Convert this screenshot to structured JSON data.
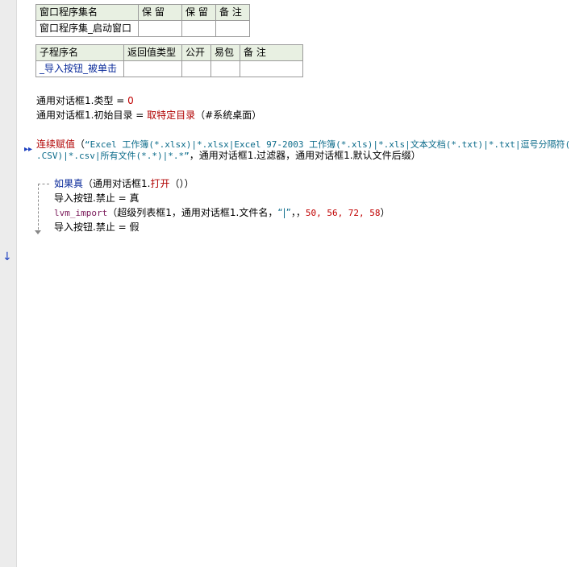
{
  "table1": {
    "headers": [
      "窗口程序集名",
      "保 留",
      "保 留",
      "备 注"
    ],
    "row": [
      "窗口程序集_启动窗口",
      "",
      "",
      ""
    ]
  },
  "table2": {
    "headers": [
      "子程序名",
      "返回值类型",
      "公开",
      "易包",
      "备 注"
    ],
    "row": [
      "_导入按钮_被单击",
      "",
      "",
      "",
      ""
    ]
  },
  "code": {
    "l1_obj": "通用对话框1.类型",
    "l1_eq": " = ",
    "l1_val": "0",
    "l2_obj": "通用对话框1.初始目录",
    "l2_eq": " = ",
    "l2_fn": "取特定目录",
    "l2_arg": "（#系统桌面）",
    "l3_fn": "连续赋值",
    "l3_open": "（",
    "l3_str1": "“Excel 工作簿(*.xlsx)|*.xlsx|Excel 97-2003 工作簿(*.xls)|*.xls|文本文档(*.txt)|*.txt|逗号分隔符(*",
    "l3_str2": ".CSV)|*.csv|所有文件(*.*)|*.*”",
    "l3_rest": "，通用对话框1.过滤器，通用对话框1.默认文件后缀）",
    "if_kw": "如果真",
    "if_open": "（通用对话框1.",
    "if_fn": "打开",
    "if_close": "（））",
    "s1_obj": "导入按钮.禁止",
    "s1_eq": " = ",
    "s1_val": "真",
    "s2_fn": "lvm_import",
    "s2_args_a": "（超级列表框1，通用对话框1.文件名，",
    "s2_str": "“|”",
    "s2_args_b": "，，",
    "s2_nums": "50, 56, 72, 58",
    "s2_close": "）",
    "s3_obj": "导入按钮.禁止",
    "s3_eq": " = ",
    "s3_val": "假"
  },
  "colors": {
    "header_bg": "#e8f0e2",
    "keyword_blue": "#0a2a9a",
    "string_teal": "#0b6b8a",
    "number_red": "#c00000"
  },
  "icons": {
    "gutter": "down-arrow-icon",
    "continuation": "double-chevron-icon"
  }
}
